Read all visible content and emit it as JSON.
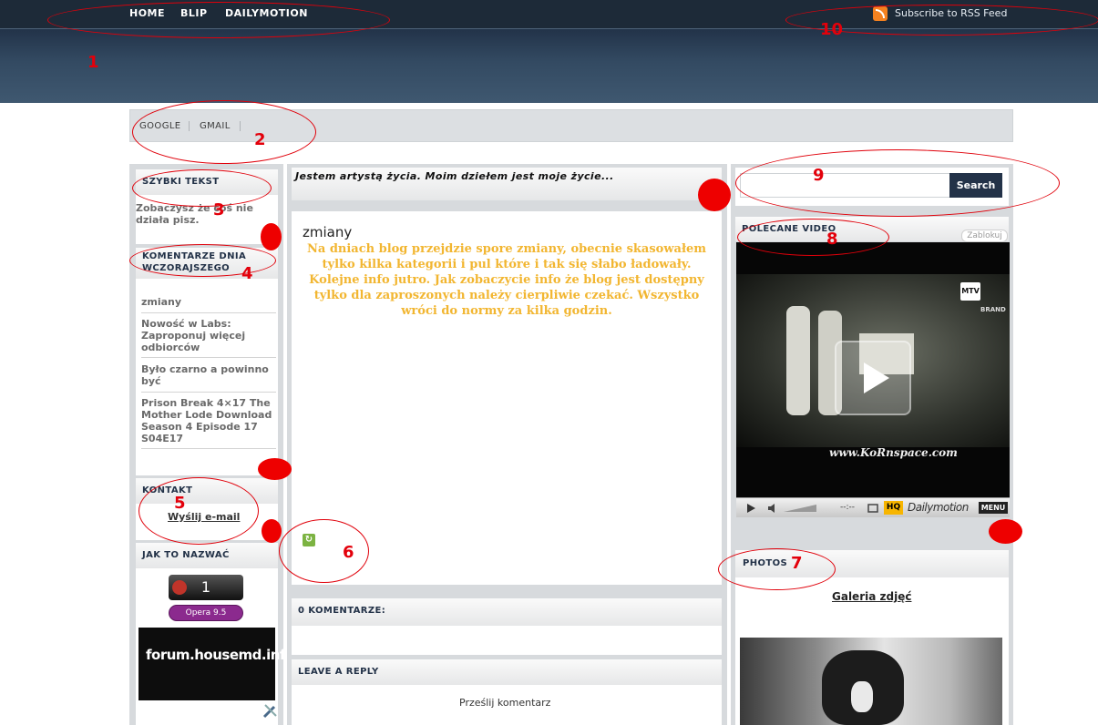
{
  "header": {
    "nav": [
      "HOME",
      "BLIP",
      "DAILYMOTION"
    ],
    "rss_label": "Subscribe to RSS Feed"
  },
  "submenu": [
    "GOOGLE",
    "GMAIL"
  ],
  "left": {
    "quick_title": "SZYBKI TEKST",
    "quick_text": "Zobaczysz że coś nie działa pisz.",
    "comments_title": "KOMENTARZE DNIA WCZORAJSZEGO",
    "comments": [
      "zmiany",
      "Nowość w Labs: Zaproponuj więcej odbiorców",
      "Było czarno a powinno być",
      "Prison Break 4×17 The Mother Lode Download Season 4 Episode 17 S04E17"
    ],
    "contact_title": "KONTAKT",
    "contact_link": "Wyślij e-mail",
    "name_title": "JAK TO NAZWAĆ",
    "counter_value": "1",
    "opera_badge": "Opera 9.5",
    "forum_banner": "forum.housemd.info.pl"
  },
  "center": {
    "tagline": "Jestem artystą życia. Moim dziełem jest moje życie...",
    "post_title": "zmiany",
    "post_body": "Na dniach blog przejdzie spore zmiany, obecnie skasowałem tylko kilka kategorii i pul które i tak się słabo ładowały. Kolejne info jutro. Jak zobaczycie info że blog jest dostępny tylko dla zaproszonych należy cierpliwie czekać. Wszystko wróci do normy za kilka godzin.",
    "comments_header": "0 KOMENTARZE:",
    "reply_header": "LEAVE A REPLY",
    "submit_comment": "Prześlij komentarz"
  },
  "right": {
    "search_button": "Search",
    "video_title": "POLECANE VIDEO",
    "video_block": "Zablokuj",
    "video_watermark": "www.KoRnspace.com",
    "player_brand": "Dailymotion",
    "player_menu": "MENU",
    "player_hq": "HQ",
    "player_time": "--:--",
    "mtv_logo": "MTV",
    "mtv_brand": "BRAND",
    "photos_title": "PHOTOS",
    "gallery_link": "Galeria zdjęć"
  },
  "annotations": [
    "1",
    "2",
    "3",
    "4",
    "5",
    "6",
    "7",
    "8",
    "9",
    "10"
  ],
  "colors": {
    "header_dark": "#1d2a38",
    "header_mid": "#334a62",
    "post_text": "#f2b631",
    "annotation": "#e3000b",
    "search_button": "#233248"
  },
  "icons": [
    "rss-icon",
    "share-icon",
    "play-icon",
    "volume-icon",
    "fullscreen-icon",
    "tools-icon"
  ]
}
